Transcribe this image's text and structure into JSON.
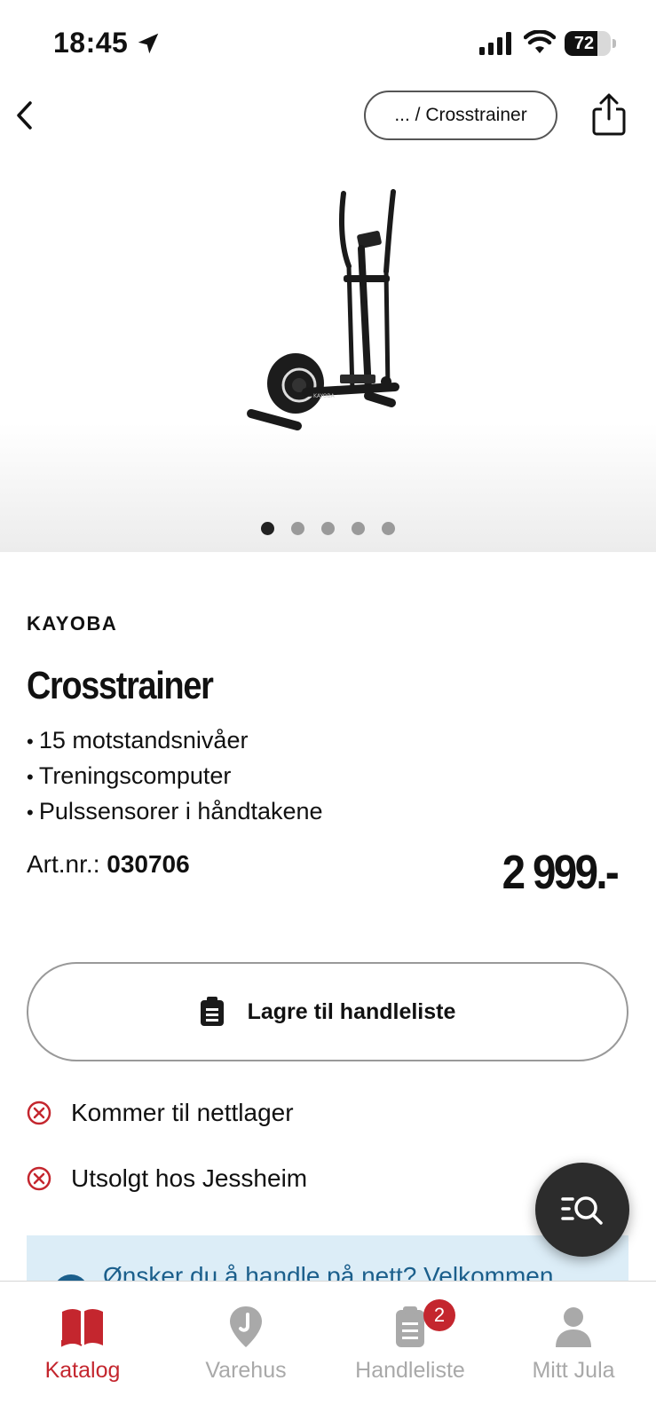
{
  "status_bar": {
    "time": "18:45",
    "battery": "72",
    "battery_level": 0.72
  },
  "nav": {
    "breadcrumb": "... / Crosstrainer"
  },
  "gallery": {
    "image_count": 5,
    "active_index": 0
  },
  "product": {
    "brand": "KAYOBA",
    "title": "Crosstrainer",
    "bullets": [
      "15 motstandsnivåer",
      "Treningscomputer",
      "Pulssensorer i håndtakene"
    ],
    "artnr_label": "Art.nr.:",
    "artnr": "030706",
    "price": "2 999.-"
  },
  "actions": {
    "save_label": "Lagre til handleliste"
  },
  "availability": [
    {
      "text": "Kommer til nettlager",
      "icon": "x-circle-icon"
    },
    {
      "text": "Utsolgt hos Jessheim",
      "icon": "x-circle-icon"
    }
  ],
  "info_banner": {
    "text": "Ønsker du å handle på nett? Velkommen"
  },
  "tab_bar": {
    "tabs": [
      {
        "label": "Katalog",
        "icon": "book-icon",
        "active": true
      },
      {
        "label": "Varehus",
        "icon": "location-pin-icon",
        "active": false
      },
      {
        "label": "Handleliste",
        "icon": "clipboard-icon",
        "active": false,
        "badge": "2"
      },
      {
        "label": "Mitt Jula",
        "icon": "person-icon",
        "active": false
      }
    ]
  },
  "colors": {
    "accent": "#c4262e",
    "banner_bg": "#dcedf7",
    "banner_text": "#1b5f8c",
    "fab": "#2c2c2c"
  }
}
